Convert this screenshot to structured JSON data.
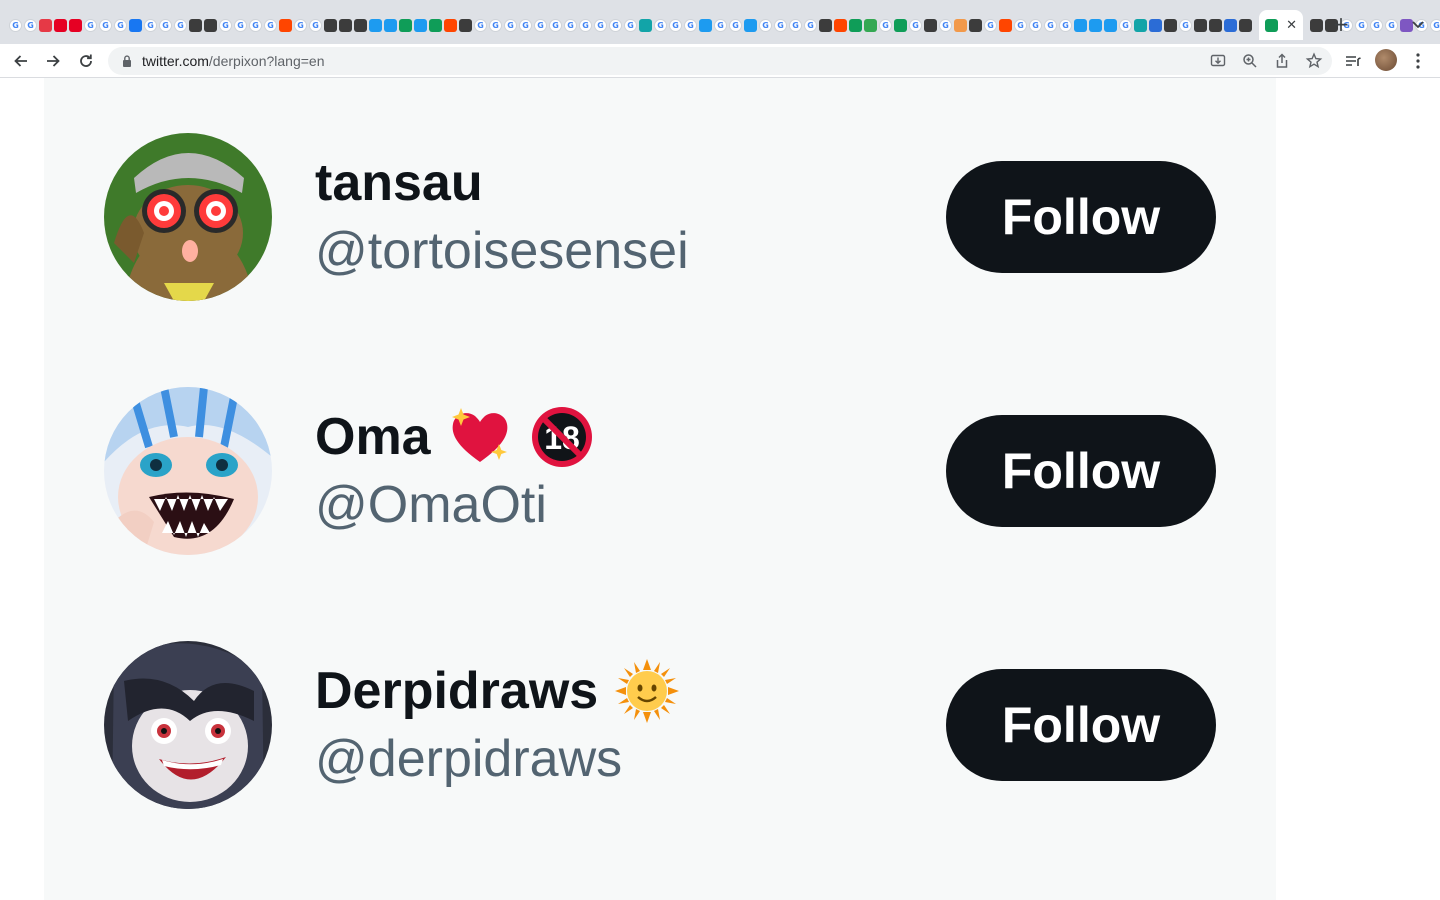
{
  "browser": {
    "url_host": "twitter.com",
    "url_rest": "/derpixon?lang=en",
    "tab_favicons": [
      "google",
      "google",
      "reddit-red",
      "pinterest",
      "pinterest",
      "google",
      "google",
      "google",
      "facebook",
      "google",
      "google",
      "google",
      "dark",
      "dark",
      "google",
      "google",
      "google",
      "google",
      "reddit",
      "google",
      "google",
      "dark",
      "dark",
      "dark",
      "twitter",
      "twitter",
      "green",
      "twitter",
      "green",
      "reddit",
      "dark",
      "google",
      "google",
      "google",
      "google",
      "google",
      "google",
      "google",
      "google",
      "google",
      "google",
      "google",
      "teal",
      "google",
      "google",
      "google",
      "twitter",
      "google",
      "google",
      "twitter",
      "google",
      "google",
      "google",
      "google",
      "dark",
      "reddit",
      "green",
      "drive",
      "google",
      "green",
      "google",
      "dark",
      "google",
      "orange",
      "dark",
      "google",
      "reddit",
      "google",
      "google",
      "google",
      "google",
      "twitter",
      "twitter",
      "twitter",
      "google",
      "teal",
      "blue",
      "dark",
      "google",
      "dark",
      "dark",
      "blue",
      "dark",
      "dark",
      "dark",
      "google",
      "google",
      "google",
      "google",
      "purple",
      "google",
      "google"
    ],
    "colors": {
      "tab_bg": "#dee1e6",
      "omnibox_bg": "#f1f3f4"
    }
  },
  "suggestions": [
    {
      "display_name": "tansau",
      "handle": "@tortoisesensei",
      "badges": [],
      "follow_label": "Follow",
      "avatar_colors": [
        "#3f7a2a",
        "#8a6a3a"
      ]
    },
    {
      "display_name": "Oma",
      "handle": "@OmaOti",
      "badges": [
        "sparkling-heart-icon",
        "no-under-18-icon"
      ],
      "follow_label": "Follow",
      "avatar_colors": [
        "#b7d3f0",
        "#f6d9cf"
      ]
    },
    {
      "display_name": "Derpidraws",
      "handle": "@derpidraws",
      "badges": [
        "sun-with-face-icon"
      ],
      "follow_label": "Follow",
      "avatar_colors": [
        "#2b2e3a",
        "#e7e3e6"
      ]
    }
  ],
  "colors": {
    "follow_button": "#0f1419",
    "handle_text": "#536471",
    "name_text": "#0f1419",
    "panel_bg": "#f7f9f9"
  }
}
